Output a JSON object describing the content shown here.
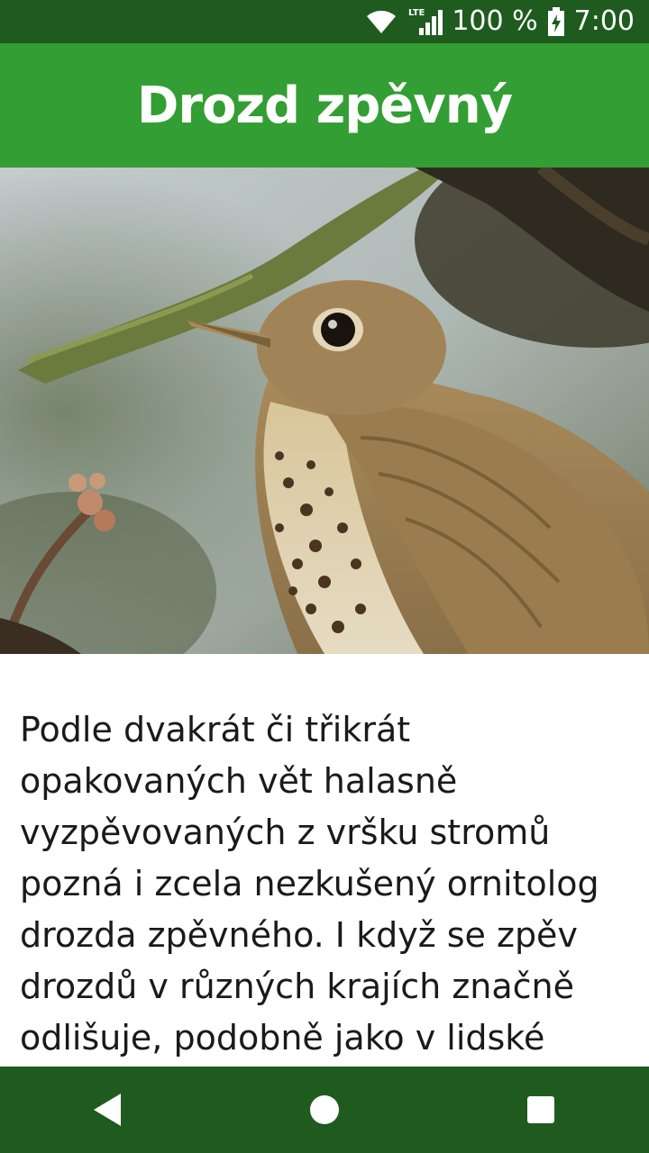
{
  "status_bar": {
    "network_label": "LTE",
    "battery_text": "100 %",
    "time": "7:00",
    "icons": [
      "wifi-icon",
      "cellular-signal-icon",
      "battery-charging-icon"
    ]
  },
  "app_bar": {
    "title": "Drozd zpěvný",
    "color": "#339e33"
  },
  "hero_image": {
    "subject": "song-thrush-photo"
  },
  "content": {
    "description": "Podle dvakrát či třikrát opakovaných vět halasně vyzpěvovaných z vršku stromů pozná i zcela nezkušený ornitolog drozda zpěvného. I když se zpěv drozdů v různých krajích značně odlišuje, podobně jako v lidské"
  },
  "nav_bar": {
    "color": "#1f5b1f",
    "buttons": [
      "back-icon",
      "home-icon",
      "recents-icon"
    ]
  }
}
